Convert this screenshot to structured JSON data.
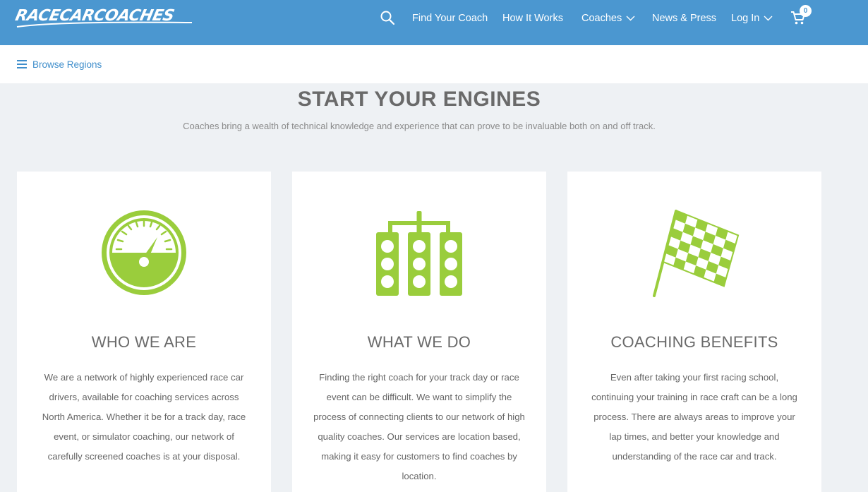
{
  "brand": {
    "logo_text": "RACECARCOACHES",
    "accent": "#4b97d0",
    "icon_green": "#9acd3c"
  },
  "nav": {
    "search_icon": "search-icon",
    "items": [
      {
        "label": "Find Your Coach"
      },
      {
        "label": "How It Works"
      },
      {
        "label": "Coaches"
      },
      {
        "label": "News & Press"
      },
      {
        "label": "Log In"
      }
    ],
    "cart_count": "0"
  },
  "subnav": {
    "browse_label": "Browse Regions"
  },
  "hero": {
    "title": "START YOUR ENGINES",
    "subtitle": "Coaches bring a wealth of technical knowledge and experience that can prove to be invaluable both on and off track."
  },
  "cards": [
    {
      "icon": "speedometer-icon",
      "title": "WHO WE ARE",
      "text": "We are a network of highly experienced race car drivers, available for coaching services across North America. Whether it be for a track day, race event, or simulator coaching, our network of carefully screened coaches is at your disposal."
    },
    {
      "icon": "starting-lights-icon",
      "title": "WHAT WE DO",
      "text": "Finding the right coach for your track day or race event can be difficult. We want to simplify the process of connecting clients to our network of high quality coaches. Our services are location based, making it easy for customers to find coaches by location."
    },
    {
      "icon": "checkered-flag-icon",
      "title": "COACHING BENEFITS",
      "text": "Even after taking your first racing school, continuing your training in race craft can be a long process. There are always areas to improve your lap times, and better your knowledge and understanding of the race car and track."
    }
  ]
}
